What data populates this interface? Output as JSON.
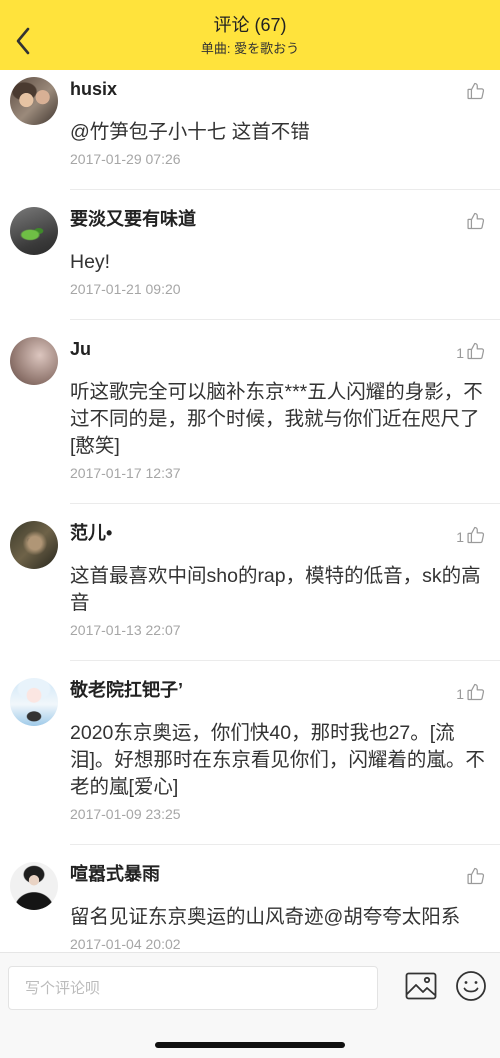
{
  "theme": {
    "header_color": "#FFE33C"
  },
  "icons": {
    "back": "chevron-left-icon",
    "like": "thumbs-up-icon",
    "image": "image-icon",
    "emoji": "emoji-icon"
  },
  "header": {
    "title": "评论 (67)",
    "subtitle": "单曲: 愛を歌おう"
  },
  "comments": [
    {
      "username": "husix",
      "text": "@竹笋包子小十七 这首不错",
      "time": "2017-01-29 07:26"
    },
    {
      "username": "要淡又要有味道",
      "text": "Hey!",
      "time": "2017-01-21 09:20"
    },
    {
      "username": "Ju",
      "text": "听这歌完全可以脑补东京***五人闪耀的身影，不过不同的是，那个时候，我就与你们近在咫尺了[憨笑]",
      "time": "2017-01-17 12:37",
      "like_count": "1"
    },
    {
      "username": "范儿•",
      "text": "这首最喜欢中间sho的rap，模特的低音，sk的高音",
      "time": "2017-01-13 22:07",
      "like_count": "1"
    },
    {
      "username": "敬老院扛钯子’",
      "text": "2020东京奥运，你们快40，那时我也27。[流泪]。好想那时在东京看见你们，闪耀着的嵐。不老的嵐[爱心]",
      "time": "2017-01-09 23:25",
      "like_count": "1"
    },
    {
      "username": "喧嚣式暴雨",
      "text": "留名见证东京奥运的山风奇迹@胡夸夸太阳系",
      "time": "2017-01-04 20:02"
    }
  ],
  "composer": {
    "placeholder": "写个评论呗"
  }
}
